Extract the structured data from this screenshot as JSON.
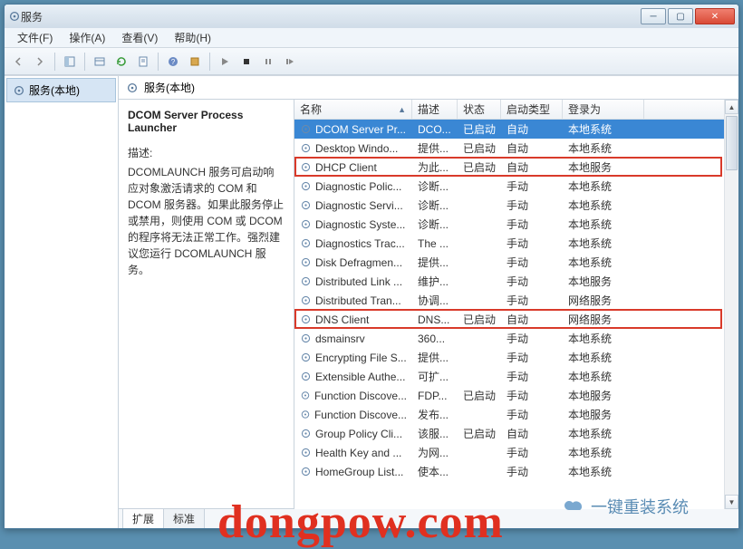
{
  "window": {
    "title": "服务"
  },
  "menu": {
    "file": "文件(F)",
    "action": "操作(A)",
    "view": "查看(V)",
    "help": "帮助(H)"
  },
  "nav": {
    "root": "服务(本地)"
  },
  "mainhead": {
    "title": "服务(本地)"
  },
  "detail": {
    "name": "DCOM Server Process Launcher",
    "label": "描述:",
    "text": "DCOMLAUNCH 服务可启动响应对象激活请求的 COM 和 DCOM 服务器。如果此服务停止或禁用，则使用 COM 或 DCOM 的程序将无法正常工作。强烈建议您运行 DCOMLAUNCH 服务。"
  },
  "columns": {
    "name": "名称",
    "desc": "描述",
    "status": "状态",
    "start": "启动类型",
    "logon": "登录为"
  },
  "rows": [
    {
      "name": "DCOM Server Pr...",
      "desc": "DCO...",
      "status": "已启动",
      "start": "自动",
      "logon": "本地系统",
      "sel": true
    },
    {
      "name": "Desktop Windo...",
      "desc": "提供...",
      "status": "已启动",
      "start": "自动",
      "logon": "本地系统"
    },
    {
      "name": "DHCP Client",
      "desc": "为此...",
      "status": "已启动",
      "start": "自动",
      "logon": "本地服务",
      "hl": true
    },
    {
      "name": "Diagnostic Polic...",
      "desc": "诊断...",
      "status": "",
      "start": "手动",
      "logon": "本地系统"
    },
    {
      "name": "Diagnostic Servi...",
      "desc": "诊断...",
      "status": "",
      "start": "手动",
      "logon": "本地系统"
    },
    {
      "name": "Diagnostic Syste...",
      "desc": "诊断...",
      "status": "",
      "start": "手动",
      "logon": "本地系统"
    },
    {
      "name": "Diagnostics Trac...",
      "desc": "The ...",
      "status": "",
      "start": "手动",
      "logon": "本地系统"
    },
    {
      "name": "Disk Defragmen...",
      "desc": "提供...",
      "status": "",
      "start": "手动",
      "logon": "本地系统"
    },
    {
      "name": "Distributed Link ...",
      "desc": "维护...",
      "status": "",
      "start": "手动",
      "logon": "本地服务"
    },
    {
      "name": "Distributed Tran...",
      "desc": "协调...",
      "status": "",
      "start": "手动",
      "logon": "网络服务"
    },
    {
      "name": "DNS Client",
      "desc": "DNS...",
      "status": "已启动",
      "start": "自动",
      "logon": "网络服务",
      "hl": true
    },
    {
      "name": "dsmainsrv",
      "desc": "360...",
      "status": "",
      "start": "手动",
      "logon": "本地系统"
    },
    {
      "name": "Encrypting File S...",
      "desc": "提供...",
      "status": "",
      "start": "手动",
      "logon": "本地系统"
    },
    {
      "name": "Extensible Authe...",
      "desc": "可扩...",
      "status": "",
      "start": "手动",
      "logon": "本地系统"
    },
    {
      "name": "Function Discove...",
      "desc": "FDP...",
      "status": "已启动",
      "start": "手动",
      "logon": "本地服务"
    },
    {
      "name": "Function Discove...",
      "desc": "发布...",
      "status": "",
      "start": "手动",
      "logon": "本地服务"
    },
    {
      "name": "Group Policy Cli...",
      "desc": "该服...",
      "status": "已启动",
      "start": "自动",
      "logon": "本地系统"
    },
    {
      "name": "Health Key and ...",
      "desc": "为网...",
      "status": "",
      "start": "手动",
      "logon": "本地系统"
    },
    {
      "name": "HomeGroup List...",
      "desc": "使本...",
      "status": "",
      "start": "手动",
      "logon": "本地系统"
    }
  ],
  "tabs": {
    "extended": "扩展",
    "standard": "标准"
  },
  "watermark": "dongpow.com",
  "watermark_sub": "一键重装系统"
}
